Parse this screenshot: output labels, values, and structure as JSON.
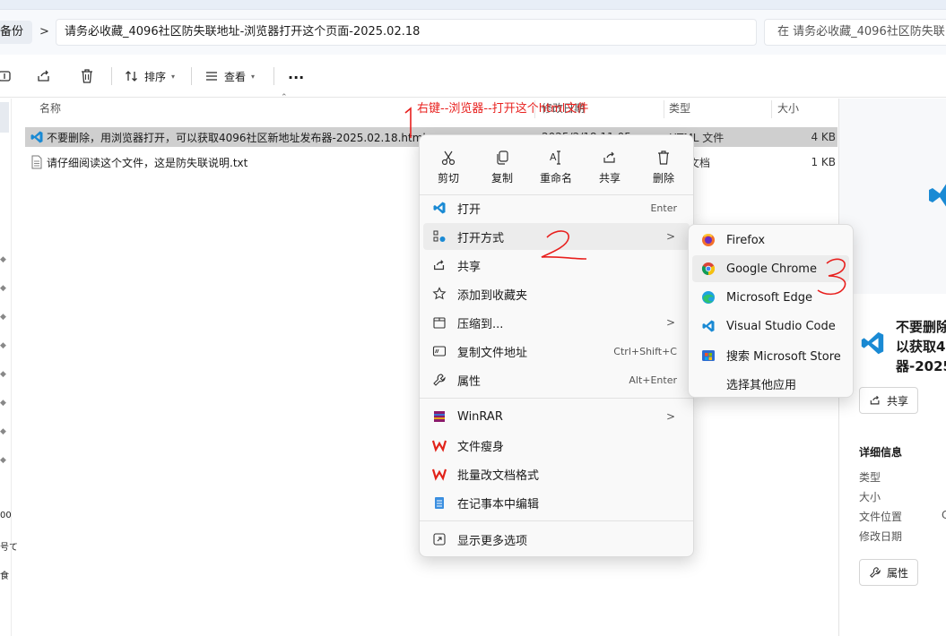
{
  "address": {
    "back_crumb": "备份",
    "separator": ">",
    "path": "请务必收藏_4096社区防失联地址-浏览器打开这个页面-2025.02.18",
    "search_placeholder": "在 请务必收藏_4096社区防失联"
  },
  "toolbar": {
    "sort_label": "排序",
    "view_label": "查看",
    "more_label": "..."
  },
  "columns": {
    "name": "名称",
    "modified": "修改日期",
    "type": "类型",
    "size": "大小"
  },
  "files": [
    {
      "name": "不要删除，用浏览器打开，可以获取4096社区新地址发布器-2025.02.18.html",
      "modified": "2025/2/18 11:05",
      "type": "HTML 文件",
      "size": "4 KB"
    },
    {
      "name": "请仔细阅读这个文件，这是防失联说明.txt",
      "modified": "",
      "type": "文档",
      "size": "1 KB"
    }
  ],
  "annotations": {
    "instruction": "右键--浏览器--打开这个html文件"
  },
  "context_menu": {
    "top_actions": [
      {
        "label": "剪切",
        "icon": "scissors-icon"
      },
      {
        "label": "复制",
        "icon": "copy-icon"
      },
      {
        "label": "重命名",
        "icon": "rename-icon"
      },
      {
        "label": "共享",
        "icon": "share-icon"
      },
      {
        "label": "删除",
        "icon": "trash-icon"
      }
    ],
    "items": [
      {
        "label": "打开",
        "shortcut": "Enter"
      },
      {
        "label": "打开方式",
        "arrow": ">"
      },
      {
        "label": "共享"
      },
      {
        "label": "添加到收藏夹"
      },
      {
        "label": "压缩到...",
        "arrow": ">"
      },
      {
        "label": "复制文件地址",
        "shortcut": "Ctrl+Shift+C"
      },
      {
        "label": "属性",
        "shortcut": "Alt+Enter"
      },
      {
        "label": "WinRAR",
        "arrow": ">"
      },
      {
        "label": "文件瘦身"
      },
      {
        "label": "批量改文档格式"
      },
      {
        "label": "在记事本中编辑"
      },
      {
        "label": "显示更多选项"
      }
    ]
  },
  "open_with_menu": {
    "items": [
      {
        "label": "Firefox"
      },
      {
        "label": "Google Chrome"
      },
      {
        "label": "Microsoft Edge"
      },
      {
        "label": "Visual Studio Code"
      },
      {
        "label": "搜索 Microsoft Store"
      },
      {
        "label": "选择其他应用"
      }
    ]
  },
  "left_nav": {
    "fragments": [
      "00",
      "号て",
      "食"
    ]
  },
  "preview": {
    "title_lines": [
      "不要删除",
      "以获取4",
      "器-2025"
    ],
    "share_label": "共享",
    "details_heading": "详细信息",
    "detail_labels": [
      "类型",
      "大小",
      "文件位置",
      "修改日期"
    ],
    "location_fragment": "C",
    "properties_label": "属性"
  },
  "colors": {
    "accent": "#0078d4",
    "annotation_red": "#e8201e",
    "vscode_blue": "#1a8ad4"
  }
}
